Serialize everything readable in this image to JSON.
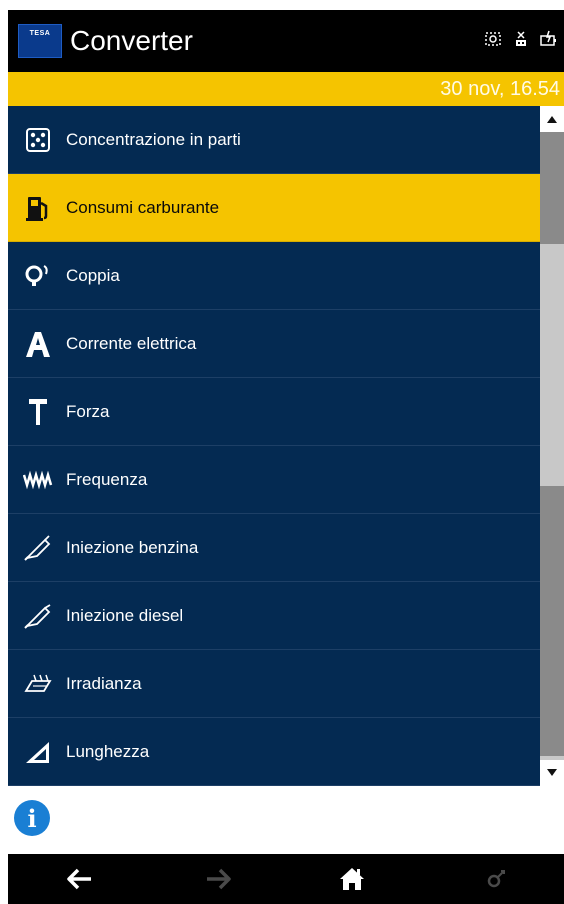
{
  "header": {
    "logo_text": "TESA",
    "title": "Converter",
    "status_icons": [
      "screen-capture-icon",
      "usb-disconnected-icon",
      "battery-charging-icon"
    ]
  },
  "datebar": {
    "date": "30 nov, 16.54"
  },
  "list": {
    "items": [
      {
        "label": "Concentrazione in parti",
        "icon": "concentration-icon",
        "selected": false
      },
      {
        "label": "Consumi carburante",
        "icon": "fuel-pump-icon",
        "selected": true
      },
      {
        "label": "Coppia",
        "icon": "torque-icon",
        "selected": false
      },
      {
        "label": "Corrente elettrica",
        "icon": "ampere-icon",
        "selected": false
      },
      {
        "label": "Forza",
        "icon": "force-icon",
        "selected": false
      },
      {
        "label": "Frequenza",
        "icon": "frequency-icon",
        "selected": false
      },
      {
        "label": "Iniezione benzina",
        "icon": "petrol-injector-icon",
        "selected": false
      },
      {
        "label": "Iniezione diesel",
        "icon": "diesel-injector-icon",
        "selected": false
      },
      {
        "label": "Irradianza",
        "icon": "irradiance-icon",
        "selected": false
      },
      {
        "label": "Lunghezza",
        "icon": "length-icon",
        "selected": false
      }
    ]
  },
  "info": {
    "icon": "info-icon",
    "glyph": "i"
  },
  "navbar": {
    "buttons": [
      "back-arrow-icon",
      "forward-arrow-icon",
      "home-icon",
      "settings-icon"
    ]
  },
  "colors": {
    "accent": "#f5c400",
    "list_bg": "#042a52",
    "header_bg": "#000000",
    "info_blue": "#1a7fd4"
  }
}
